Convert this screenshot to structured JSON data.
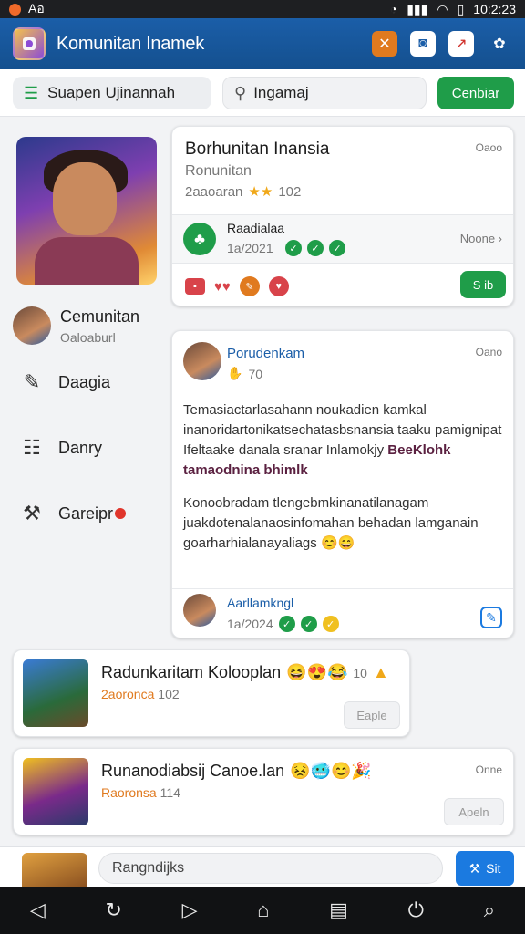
{
  "status_bar": {
    "app_label": "Aอ",
    "time": "10:2:23"
  },
  "app_bar": {
    "title": "Komunitan Inamek"
  },
  "filter_row": {
    "menu_label": "Suapen Ujinannah",
    "search_placeholder": "Ingamaj",
    "action_label": "Cenbiar"
  },
  "sidebar": {
    "profile_name": "Cemunitan",
    "profile_sub": "Oaloaburl",
    "items": [
      {
        "label": "Daagia"
      },
      {
        "label": "Danry"
      },
      {
        "label": "Gareipr"
      }
    ]
  },
  "community_card": {
    "title": "Borhunitan Inansia",
    "subtitle": "Ronunitan",
    "meta": "2aaoaran",
    "count": "102",
    "corner": "Oaoo",
    "sub_name": "Raadialaa",
    "sub_meta": "1a/2021",
    "sub_right": "Noone",
    "join_label": "S ib"
  },
  "post": {
    "author": "Porudenkam",
    "corner": "Oano",
    "reactions": "70",
    "text1": "Temasiactarlasahann noukadien kamkal inanoridartonikatsechatasbsnansia taaku pamignipat",
    "text2": "Ifeltaake danala sranar Inlamokjy",
    "text2_bold": "BeeKlohk tamaodnina bhimlk",
    "text3": "Konoobradam tlengebmkinanatilanagam juakdotenalanaosinfomahan behadan lamganain goarharhialanayaliags",
    "footer_name": "Aarllamkngl",
    "footer_meta": "1a/2024"
  },
  "list_items": [
    {
      "title": "Radunkaritam Kolooplan",
      "count": "10",
      "meta_a": "2aoronca",
      "meta_b": "102",
      "button": "Eaple",
      "corner": ""
    },
    {
      "title": "Runanodiabsij Canoe.lan",
      "count": "",
      "meta_a": "Raoronsa",
      "meta_b": "114",
      "button": "Apeln",
      "corner": "Onne"
    }
  ],
  "composer": {
    "placeholder": "Rangndijks",
    "send_label": "Sit"
  },
  "colors": {
    "primary": "#1b5ea8",
    "green": "#1f9d49",
    "orange": "#e07a1f"
  }
}
